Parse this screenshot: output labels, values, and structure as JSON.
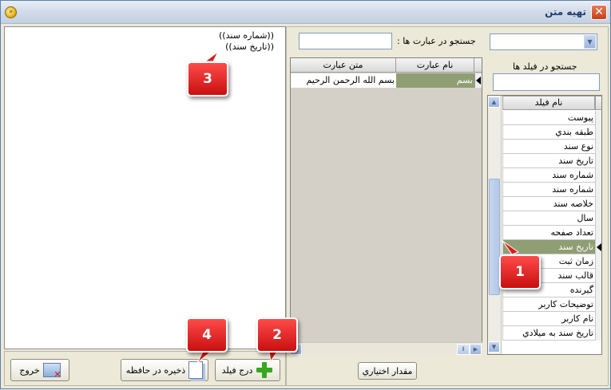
{
  "window": {
    "title": "تهيه متن",
    "close_glyph": "✕",
    "app_glyph": "»"
  },
  "editor": {
    "lines": [
      "((شماره سند))",
      "((تاريخ سند))"
    ]
  },
  "buttons": {
    "exit_label": "خروج",
    "save_clipboard_label": "ذخيره در حافظه",
    "insert_field_label": "درج فيلد",
    "custom_value_label": "مقدار اختياري"
  },
  "search_expressions": {
    "label": "جستجو در عبارت ها :",
    "value": ""
  },
  "fields_search": {
    "label": "جستجو در فيلد ها",
    "value": ""
  },
  "dropdown": {
    "selected": ""
  },
  "expressions_grid": {
    "headers": [
      "نام عبارت",
      "متن عبارت"
    ],
    "rows": [
      {
        "name": "بسم",
        "text": "بسم الله الرحمن الرحيم"
      }
    ]
  },
  "fields_list": {
    "header": "نام فيلد",
    "selected_item": "تاريخ سند",
    "items": [
      "پيوست",
      "طبقه بندي",
      "نوع سند",
      "تاريخ سند",
      "شماره سند",
      "شماره سند",
      "خلاصه سند",
      "سال",
      "تعداد صفحه",
      "تاريخ سند",
      "زمان ثبت",
      "قالب سند",
      "گيرنده",
      "توضيحات كاربر",
      "نام كاربر",
      "تاريخ سند به ميلادي"
    ]
  },
  "callouts": [
    "1",
    "2",
    "3",
    "4"
  ],
  "colors": {
    "selected_row": "#8f9e73",
    "callout": "#d81e1e",
    "accent": "#5b7fa8"
  }
}
